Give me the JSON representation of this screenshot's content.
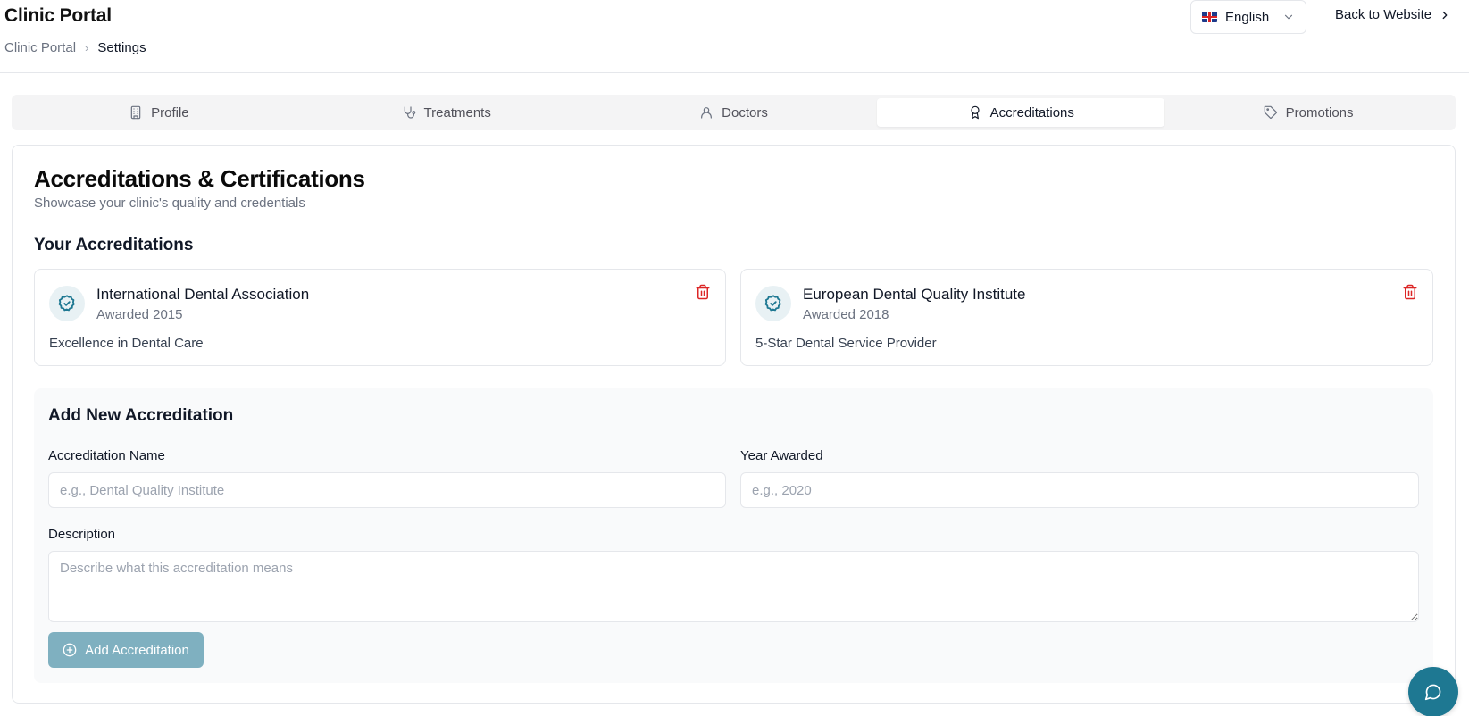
{
  "header": {
    "app_title": "Clinic Portal",
    "breadcrumb": {
      "root": "Clinic Portal",
      "separator": "›",
      "current": "Settings"
    },
    "language": {
      "selected": "English",
      "flag_icon": "uk-flag-icon"
    },
    "back_link": "Back to Website"
  },
  "tabs": [
    {
      "label": "Profile",
      "icon": "building-icon",
      "active": false
    },
    {
      "label": "Treatments",
      "icon": "stethoscope-icon",
      "active": false
    },
    {
      "label": "Doctors",
      "icon": "user-icon",
      "active": false
    },
    {
      "label": "Accreditations",
      "icon": "award-icon",
      "active": true
    },
    {
      "label": "Promotions",
      "icon": "tag-icon",
      "active": false
    }
  ],
  "main": {
    "title": "Accreditations & Certifications",
    "subtitle": "Showcase your clinic's quality and credentials",
    "list_title": "Your Accreditations",
    "accreditations": [
      {
        "name": "International Dental Association",
        "year": "Awarded 2015",
        "description": "Excellence in Dental Care"
      },
      {
        "name": "European Dental Quality Institute",
        "year": "Awarded 2018",
        "description": "5-Star Dental Service Provider"
      }
    ]
  },
  "form": {
    "title": "Add New Accreditation",
    "name_label": "Accreditation Name",
    "name_placeholder": "e.g., Dental Quality Institute",
    "year_label": "Year Awarded",
    "year_placeholder": "e.g., 2020",
    "description_label": "Description",
    "description_placeholder": "Describe what this accreditation means",
    "submit_label": "Add Accreditation"
  },
  "colors": {
    "accent": "#1e7892",
    "button_disabled": "#7fb0c0",
    "delete": "#dc2626",
    "badge_bg": "#e8f1f4"
  }
}
